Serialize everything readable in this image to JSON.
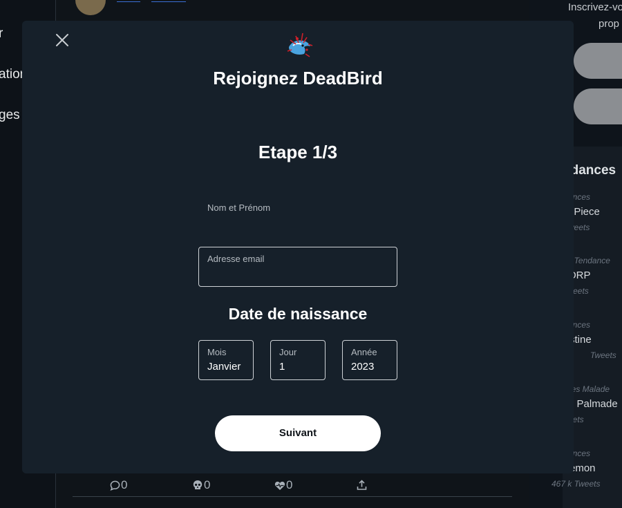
{
  "left_nav": {
    "items": [
      "r",
      "ation",
      "ges"
    ]
  },
  "feed": {
    "actions": [
      {
        "icon": "comment-icon",
        "count": "0"
      },
      {
        "icon": "skull-icon",
        "count": "0"
      },
      {
        "icon": "heart-pulse-icon",
        "count": "0"
      },
      {
        "icon": "share-icon",
        "count": ""
      }
    ]
  },
  "right_col": {
    "promo_line1": "Inscrivez-vo",
    "promo_line2": "prop",
    "trends_title": "ndances",
    "trends": [
      {
        "category": "ences",
        "name": "ePiece",
        "count": "weets"
      },
      {
        "category": "ng Tendance",
        "name": "ORP",
        "count": "Tweets"
      },
      {
        "category": "ences",
        "name": "stine",
        "count": "Tweets"
      },
      {
        "category": "nces Malade",
        "name": "e Palmade",
        "count": "eets"
      },
      {
        "category": "ences",
        "name": "emon",
        "count": "467 k Tweets"
      }
    ]
  },
  "modal": {
    "title": "Rejoignez DeadBird",
    "step": "Etape 1/3",
    "name_label": "Nom et Prénom",
    "name_value": "",
    "email_label": "Adresse email",
    "email_value": "",
    "dob_title": "Date de naissance",
    "month_label": "Mois",
    "month_value": "Janvier",
    "day_label": "Jour",
    "day_value": "1",
    "year_label": "Année",
    "year_value": "2023",
    "next_label": "Suivant"
  },
  "colors": {
    "modal_bg": "#16202a",
    "page_bg": "#0f1419",
    "button_bg": "#ffffff"
  }
}
